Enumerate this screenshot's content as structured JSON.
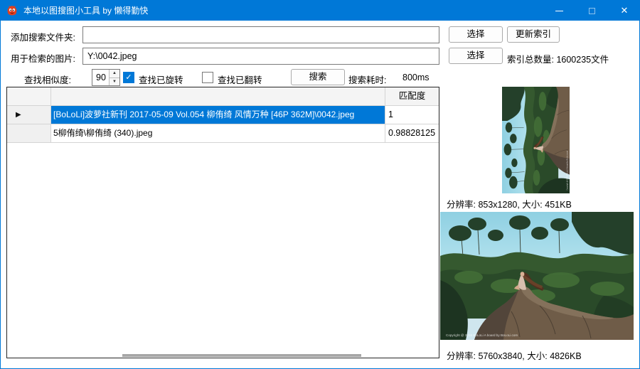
{
  "window": {
    "title": "本地以图搜图小工具 by 懒得勤快"
  },
  "icons": {
    "check": "✓",
    "row_arrow": "▶",
    "spinner_up": "▲",
    "spinner_down": "▼",
    "close": "✕"
  },
  "colors": {
    "titlebar": "#0078D7",
    "selection": "#0078D7",
    "accent": "#0078D7"
  },
  "form": {
    "add_folder_label": "添加搜索文件夹:",
    "add_folder_value": "",
    "query_image_label": "用于检索的图片:",
    "query_image_value": "Y:\\0042.jpeg",
    "choose_button": "选择",
    "update_index_button": "更新索引",
    "choose_button2": "选择",
    "index_count_label": "索引总数量: 1600235文件",
    "similarity_label": "查找相似度:",
    "similarity_value": "90",
    "rotated_checkbox_label": "查找已旋转",
    "rotated_checked": true,
    "flipped_checkbox_label": "查找已翻转",
    "flipped_checked": false,
    "search_button": "搜索",
    "elapsed_label": "搜索耗时:",
    "elapsed_value": "800ms"
  },
  "table": {
    "match_header": "匹配度",
    "rows": [
      {
        "path": "[BoLoLi]波萝社新刊 2017-05-09 Vol.054 柳侑绮 风情万种 [46P 362M]\\0042.jpeg",
        "match": "1",
        "selected": true
      },
      {
        "path": "5柳侑绮\\柳侑绮 (340).jpeg",
        "match": "0.98828125",
        "selected": false
      }
    ]
  },
  "preview": {
    "top_caption": "分辨率: 853x1280, 大小: 451KB",
    "bottom_caption": "分辨率: 5760x3840, 大小: 4826KB",
    "watermark": "Copyright @ 2016 BoLoLi A board by BoLoLi.com"
  }
}
